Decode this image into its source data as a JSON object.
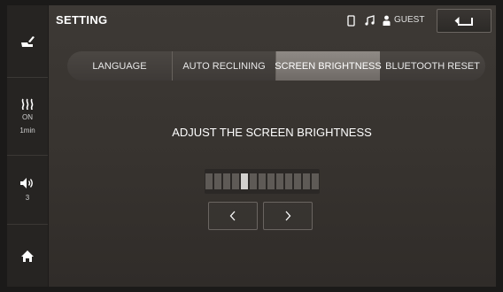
{
  "header": {
    "title": "SETTING",
    "user_label": "GUEST"
  },
  "tabs": [
    {
      "label": "LANGUAGE",
      "active": false
    },
    {
      "label": "AUTO RECLINING",
      "active": false
    },
    {
      "label": "SCREEN BRIGHTNESS",
      "active": true
    },
    {
      "label": "BLUETOOTH RESET",
      "active": false
    }
  ],
  "left_rail": {
    "seat_icon": "seat-icon",
    "heat": {
      "icon": "heat-waves-icon",
      "status": "ON",
      "timer": "1min"
    },
    "volume": {
      "icon": "speaker-icon",
      "level": "3"
    },
    "home_icon": "home-icon"
  },
  "brightness": {
    "heading": "ADJUST THE SCREEN BRIGHTNESS",
    "segments_total": 13,
    "level": 5,
    "decrease_icon": "chevron-left-icon",
    "increase_icon": "chevron-right-icon"
  },
  "colors": {
    "active_tab": "#807b77",
    "segment_on": "#d2d0ce",
    "segment_off": "#5e5a56"
  }
}
